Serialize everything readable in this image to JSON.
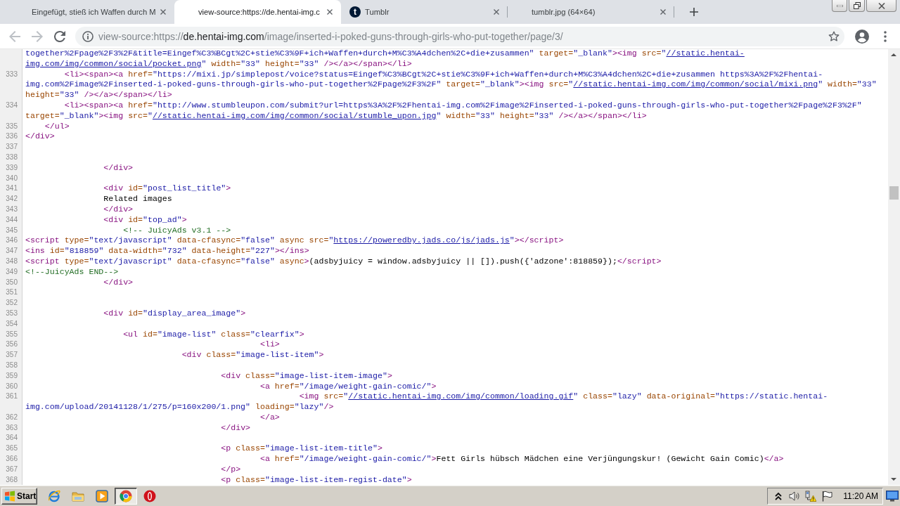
{
  "tabs": [
    {
      "title": "Eingefügt, stieß ich Waffen durch M",
      "selected": false
    },
    {
      "title": "view-source:https://de.hentai-img.c",
      "selected": true
    },
    {
      "title": "Tumblr",
      "selected": false,
      "favicon": "t"
    },
    {
      "title": "tumblr.jpg (64×64)",
      "selected": false
    }
  ],
  "navigation": [
    {
      "kind": "back",
      "disabled": true
    },
    {
      "kind": "forward",
      "disabled": true
    },
    {
      "kind": "reload",
      "disabled": false
    }
  ],
  "address_bar": {
    "scheme": "view-source:https://",
    "host": "de.hentai-img.com",
    "path": "/image/inserted-i-poked-guns-through-girls-who-put-together/page/3/"
  },
  "source": {
    "lines": [
      {
        "visual_rows": [
          {
            "parts": [
              {
                "kind": "value",
                "text": "together%2Fpage%2F3%2F&title=Eingef%C3%BCgt%2C+stie%C3%9F+ich+Waffen+durch+M%C3%A4dchen%2C+die+zusammen\""
              },
              {
                "kind": "attr",
                "text": " target="
              },
              {
                "kind": "value",
                "text": "\"_blank\""
              },
              {
                "kind": "tag",
                "text": "><img"
              },
              {
                "kind": "attr",
                "text": " src="
              },
              {
                "kind": "value",
                "text": "\""
              },
              {
                "kind": "link",
                "text": "//static.hentai-"
              }
            ]
          },
          {
            "parts": [
              {
                "kind": "link",
                "text": "img.com/img/common/social/pocket.png"
              },
              {
                "kind": "value",
                "text": "\""
              },
              {
                "kind": "attr",
                "text": " width="
              },
              {
                "kind": "value",
                "text": "\"33\""
              },
              {
                "kind": "attr",
                "text": " height="
              },
              {
                "kind": "value",
                "text": "\"33\""
              },
              {
                "kind": "tag",
                "text": " /></a></span></li>"
              }
            ]
          }
        ]
      },
      {
        "number": "333",
        "visual_rows": [
          {
            "parts": [
              {
                "kind": "tag",
                "text": "        <li><span><a"
              },
              {
                "kind": "attr",
                "text": " href="
              },
              {
                "kind": "value",
                "text": "\"https://mixi.jp/simplepost/voice?status=Eingef%C3%BCgt%2C+stie%C3%9F+ich+Waffen+durch+M%C3%A4dchen%2C+die+zusammen https%3A%2F%2Fhentai-"
              }
            ]
          },
          {
            "parts": [
              {
                "kind": "value",
                "text": "img.com%2Fimage%2Finserted-i-poked-guns-through-girls-who-put-together%2Fpage%2F3%2F\""
              },
              {
                "kind": "attr",
                "text": " target="
              },
              {
                "kind": "value",
                "text": "\"_blank\""
              },
              {
                "kind": "tag",
                "text": "><img"
              },
              {
                "kind": "attr",
                "text": " src="
              },
              {
                "kind": "value",
                "text": "\""
              },
              {
                "kind": "link",
                "text": "//static.hentai-img.com/img/common/social/mixi.png"
              },
              {
                "kind": "value",
                "text": "\""
              },
              {
                "kind": "attr",
                "text": " width="
              },
              {
                "kind": "value",
                "text": "\"33\""
              }
            ]
          },
          {
            "parts": [
              {
                "kind": "attr",
                "text": "height="
              },
              {
                "kind": "value",
                "text": "\"33\""
              },
              {
                "kind": "tag",
                "text": " /></a></span></li>"
              }
            ]
          }
        ]
      },
      {
        "number": "334",
        "visual_rows": [
          {
            "parts": [
              {
                "kind": "tag",
                "text": "        <li><span><a"
              },
              {
                "kind": "attr",
                "text": " href="
              },
              {
                "kind": "value",
                "text": "\"http://www.stumbleupon.com/submit?url=https%3A%2F%2Fhentai-img.com%2Fimage%2Finserted-i-poked-guns-through-girls-who-put-together%2Fpage%2F3%2F\""
              }
            ]
          },
          {
            "parts": [
              {
                "kind": "attr",
                "text": "target="
              },
              {
                "kind": "value",
                "text": "\"_blank\""
              },
              {
                "kind": "tag",
                "text": "><img"
              },
              {
                "kind": "attr",
                "text": " src="
              },
              {
                "kind": "value",
                "text": "\""
              },
              {
                "kind": "link",
                "text": "//static.hentai-img.com/img/common/social/stumble_upon.jpg"
              },
              {
                "kind": "value",
                "text": "\""
              },
              {
                "kind": "attr",
                "text": " width="
              },
              {
                "kind": "value",
                "text": "\"33\""
              },
              {
                "kind": "attr",
                "text": " height="
              },
              {
                "kind": "value",
                "text": "\"33\""
              },
              {
                "kind": "tag",
                "text": " /></a></span></li>"
              }
            ]
          }
        ]
      },
      {
        "number": "335",
        "visual_rows": [
          {
            "parts": [
              {
                "kind": "tag",
                "text": "    </ul>"
              }
            ]
          }
        ]
      },
      {
        "number": "336",
        "visual_rows": [
          {
            "parts": [
              {
                "kind": "tag",
                "text": "</div>"
              }
            ]
          }
        ]
      },
      {
        "number": "337"
      },
      {
        "number": "338"
      },
      {
        "number": "339",
        "visual_rows": [
          {
            "parts": [
              {
                "kind": "tag",
                "text": "                </div>"
              }
            ]
          }
        ]
      },
      {
        "number": "340"
      },
      {
        "number": "341",
        "visual_rows": [
          {
            "parts": [
              {
                "kind": "tag",
                "text": "                <div"
              },
              {
                "kind": "attr",
                "text": " id="
              },
              {
                "kind": "value",
                "text": "\"post_list_title\""
              },
              {
                "kind": "tag",
                "text": ">"
              }
            ]
          }
        ]
      },
      {
        "number": "342",
        "visual_rows": [
          {
            "parts": [
              {
                "kind": "text",
                "text": "                Related images"
              }
            ]
          }
        ]
      },
      {
        "number": "343",
        "visual_rows": [
          {
            "parts": [
              {
                "kind": "tag",
                "text": "                </div>"
              }
            ]
          }
        ]
      },
      {
        "number": "344",
        "visual_rows": [
          {
            "parts": [
              {
                "kind": "tag",
                "text": "                <div"
              },
              {
                "kind": "attr",
                "text": " id="
              },
              {
                "kind": "value",
                "text": "\"top_ad\""
              },
              {
                "kind": "tag",
                "text": ">"
              }
            ]
          }
        ]
      },
      {
        "number": "345",
        "visual_rows": [
          {
            "parts": [
              {
                "kind": "comment",
                "text": "                    <!-- JuicyAds v3.1 -->"
              }
            ]
          }
        ]
      },
      {
        "number": "346",
        "visual_rows": [
          {
            "parts": [
              {
                "kind": "tag",
                "text": "<script"
              },
              {
                "kind": "attr",
                "text": " type="
              },
              {
                "kind": "value",
                "text": "\"text/javascript\""
              },
              {
                "kind": "attr",
                "text": " data-cfasync="
              },
              {
                "kind": "value",
                "text": "\"false\""
              },
              {
                "kind": "attr",
                "text": " async src="
              },
              {
                "kind": "value",
                "text": "\""
              },
              {
                "kind": "link",
                "text": "https://poweredby.jads.co/js/jads.js"
              },
              {
                "kind": "value",
                "text": "\""
              },
              {
                "kind": "tag",
                "text": "></script>"
              }
            ]
          }
        ]
      },
      {
        "number": "347",
        "visual_rows": [
          {
            "parts": [
              {
                "kind": "tag",
                "text": "<ins"
              },
              {
                "kind": "attr",
                "text": " id="
              },
              {
                "kind": "value",
                "text": "\"818859\""
              },
              {
                "kind": "attr",
                "text": " data-width="
              },
              {
                "kind": "value",
                "text": "\"732\""
              },
              {
                "kind": "attr",
                "text": " data-height="
              },
              {
                "kind": "value",
                "text": "\"227\""
              },
              {
                "kind": "tag",
                "text": "></ins>"
              }
            ]
          }
        ]
      },
      {
        "number": "348",
        "visual_rows": [
          {
            "parts": [
              {
                "kind": "tag",
                "text": "<script"
              },
              {
                "kind": "attr",
                "text": " type="
              },
              {
                "kind": "value",
                "text": "\"text/javascript\""
              },
              {
                "kind": "attr",
                "text": " data-cfasync="
              },
              {
                "kind": "value",
                "text": "\"false\""
              },
              {
                "kind": "attr",
                "text": " async"
              },
              {
                "kind": "tag",
                "text": ">"
              },
              {
                "kind": "text",
                "text": "(adsbyjuicy = window.adsbyjuicy || []).push({'adzone':818859});"
              },
              {
                "kind": "tag",
                "text": "</script>"
              }
            ]
          }
        ]
      },
      {
        "number": "349",
        "visual_rows": [
          {
            "parts": [
              {
                "kind": "comment",
                "text": "<!--JuicyAds END-->"
              }
            ]
          }
        ]
      },
      {
        "number": "350",
        "visual_rows": [
          {
            "parts": [
              {
                "kind": "tag",
                "text": "                </div>"
              }
            ]
          }
        ]
      },
      {
        "number": "351"
      },
      {
        "number": "352"
      },
      {
        "number": "353",
        "visual_rows": [
          {
            "parts": [
              {
                "kind": "tag",
                "text": "                <div"
              },
              {
                "kind": "attr",
                "text": " id="
              },
              {
                "kind": "value",
                "text": "\"display_area_image\""
              },
              {
                "kind": "tag",
                "text": ">"
              }
            ]
          }
        ]
      },
      {
        "number": "354"
      },
      {
        "number": "355",
        "visual_rows": [
          {
            "parts": [
              {
                "kind": "tag",
                "text": "                    <ul"
              },
              {
                "kind": "attr",
                "text": " id="
              },
              {
                "kind": "value",
                "text": "\"image-list\""
              },
              {
                "kind": "attr",
                "text": " class="
              },
              {
                "kind": "value",
                "text": "\"clearfix\""
              },
              {
                "kind": "tag",
                "text": ">"
              }
            ]
          }
        ]
      },
      {
        "number": "356",
        "visual_rows": [
          {
            "parts": [
              {
                "kind": "tag",
                "text": "                                                <li>"
              }
            ]
          }
        ]
      },
      {
        "number": "357",
        "visual_rows": [
          {
            "parts": [
              {
                "kind": "tag",
                "text": "                                <div"
              },
              {
                "kind": "attr",
                "text": " class="
              },
              {
                "kind": "value",
                "text": "\"image-list-item\""
              },
              {
                "kind": "tag",
                "text": ">"
              }
            ]
          }
        ]
      },
      {
        "number": "358"
      },
      {
        "number": "359",
        "visual_rows": [
          {
            "parts": [
              {
                "kind": "tag",
                "text": "                                        <div"
              },
              {
                "kind": "attr",
                "text": " class="
              },
              {
                "kind": "value",
                "text": "\"image-list-item-image\""
              },
              {
                "kind": "tag",
                "text": ">"
              }
            ]
          }
        ]
      },
      {
        "number": "360",
        "visual_rows": [
          {
            "parts": [
              {
                "kind": "tag",
                "text": "                                                <a"
              },
              {
                "kind": "attr",
                "text": " href="
              },
              {
                "kind": "value",
                "text": "\"/image/weight-gain-comic/\""
              },
              {
                "kind": "tag",
                "text": ">"
              }
            ]
          }
        ]
      },
      {
        "number": "361",
        "visual_rows": [
          {
            "parts": [
              {
                "kind": "tag",
                "text": "                                                        <img"
              },
              {
                "kind": "attr",
                "text": " src="
              },
              {
                "kind": "value",
                "text": "\""
              },
              {
                "kind": "link",
                "text": "//static.hentai-img.com/img/common/loading.gif"
              },
              {
                "kind": "value",
                "text": "\""
              },
              {
                "kind": "attr",
                "text": " class="
              },
              {
                "kind": "value",
                "text": "\"lazy\""
              },
              {
                "kind": "attr",
                "text": " data-original="
              },
              {
                "kind": "value",
                "text": "\"https://static.hentai-"
              }
            ]
          },
          {
            "parts": [
              {
                "kind": "value",
                "text": "img.com/upload/20141128/1/275/p=160x200/1.png\""
              },
              {
                "kind": "attr",
                "text": " loading="
              },
              {
                "kind": "value",
                "text": "\"lazy\""
              },
              {
                "kind": "tag",
                "text": "/>"
              }
            ]
          }
        ]
      },
      {
        "number": "362",
        "visual_rows": [
          {
            "parts": [
              {
                "kind": "tag",
                "text": "                                                </a>"
              }
            ]
          }
        ]
      },
      {
        "number": "363",
        "visual_rows": [
          {
            "parts": [
              {
                "kind": "tag",
                "text": "                                        </div>"
              }
            ]
          }
        ]
      },
      {
        "number": "364"
      },
      {
        "number": "365",
        "visual_rows": [
          {
            "parts": [
              {
                "kind": "tag",
                "text": "                                        <p"
              },
              {
                "kind": "attr",
                "text": " class="
              },
              {
                "kind": "value",
                "text": "\"image-list-item-title\""
              },
              {
                "kind": "tag",
                "text": ">"
              }
            ]
          }
        ]
      },
      {
        "number": "366",
        "visual_rows": [
          {
            "parts": [
              {
                "kind": "tag",
                "text": "                                                <a"
              },
              {
                "kind": "attr",
                "text": " href="
              },
              {
                "kind": "value",
                "text": "\"/image/weight-gain-comic/\""
              },
              {
                "kind": "tag",
                "text": ">"
              },
              {
                "kind": "text",
                "text": "Fett Girls hübsch Mädchen eine Verjüngungskur! (Gewicht Gain Comic)"
              },
              {
                "kind": "tag",
                "text": "</a>"
              }
            ]
          }
        ]
      },
      {
        "number": "367",
        "visual_rows": [
          {
            "parts": [
              {
                "kind": "tag",
                "text": "                                        </p>"
              }
            ]
          }
        ]
      },
      {
        "number": "368",
        "visual_rows": [
          {
            "parts": [
              {
                "kind": "tag",
                "text": "                                        <p"
              },
              {
                "kind": "attr",
                "text": " class="
              },
              {
                "kind": "value",
                "text": "\"image-list-item-regist-date\""
              },
              {
                "kind": "tag",
                "text": ">"
              }
            ]
          }
        ]
      }
    ]
  },
  "taskbar": {
    "start": "Start",
    "apps": [
      {
        "kind": "globe",
        "selected": false
      },
      {
        "kind": "folder",
        "selected": false
      },
      {
        "kind": "player",
        "selected": false
      },
      {
        "kind": "wheel",
        "selected": true
      },
      {
        "kind": "ring",
        "selected": false
      }
    ],
    "clock": "11:20 AM"
  }
}
